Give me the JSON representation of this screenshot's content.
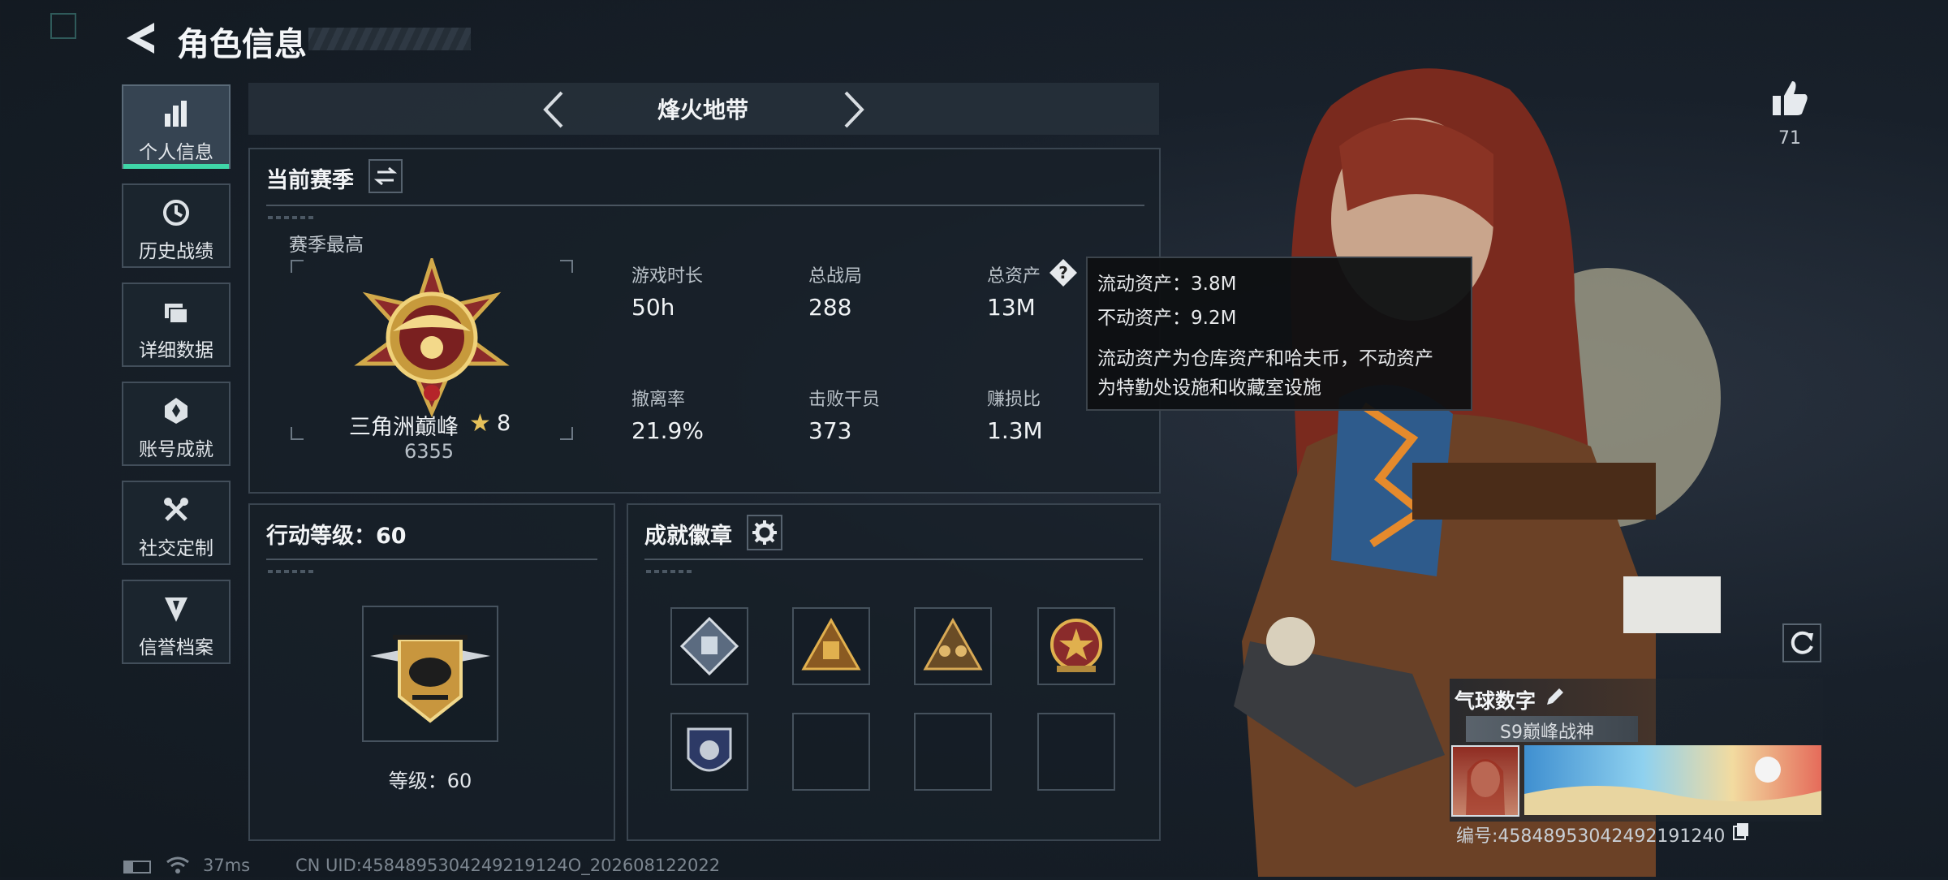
{
  "header": {
    "title": "角色信息"
  },
  "sidebar": {
    "items": [
      {
        "label": "个人信息",
        "icon": "bar-chart-icon",
        "active": true
      },
      {
        "label": "历史战绩",
        "icon": "history-icon"
      },
      {
        "label": "详细数据",
        "icon": "folder-icon"
      },
      {
        "label": "账号成就",
        "icon": "achievement-icon"
      },
      {
        "label": "社交定制",
        "icon": "tools-icon"
      },
      {
        "label": "信誉档案",
        "icon": "reputation-icon"
      }
    ]
  },
  "mode_selector": {
    "label": "烽火地带"
  },
  "season": {
    "title": "当前赛季",
    "best_label": "赛季最高",
    "rank_name": "三角洲巅峰",
    "rank_stars": "8",
    "rank_score": "6355",
    "stats": [
      {
        "label": "游戏时长",
        "value": "50h"
      },
      {
        "label": "总战局",
        "value": "288"
      },
      {
        "label": "总资产",
        "value": "13M"
      },
      {
        "label": "撤离率",
        "value": "21.9%"
      },
      {
        "label": "击败干员",
        "value": "373"
      },
      {
        "label": "赚损比",
        "value": "1.3M"
      }
    ]
  },
  "tooltip": {
    "line1": "流动资产：3.8M",
    "line2": "不动资产：9.2M",
    "desc1": "流动资产为仓库资产和哈夫币，不动资产",
    "desc2": "为特勤处设施和收藏室设施"
  },
  "action_level": {
    "title": "行动等级：60",
    "level_label": "等级：60"
  },
  "badges": {
    "title": "成就徽章",
    "slots": [
      "diamond-badge",
      "pyramid-badge",
      "squad-badge",
      "star-emblem-badge",
      "shield-badge",
      "",
      "",
      ""
    ]
  },
  "likes": {
    "count": "71"
  },
  "profile_card": {
    "name": "气球数字",
    "title": "S9巅峰战神",
    "id_text": "编号:458489530424921912­40"
  },
  "status_bar": {
    "ping": "37ms",
    "uid": "CN UID:4584895304249219124O_202608122022"
  }
}
